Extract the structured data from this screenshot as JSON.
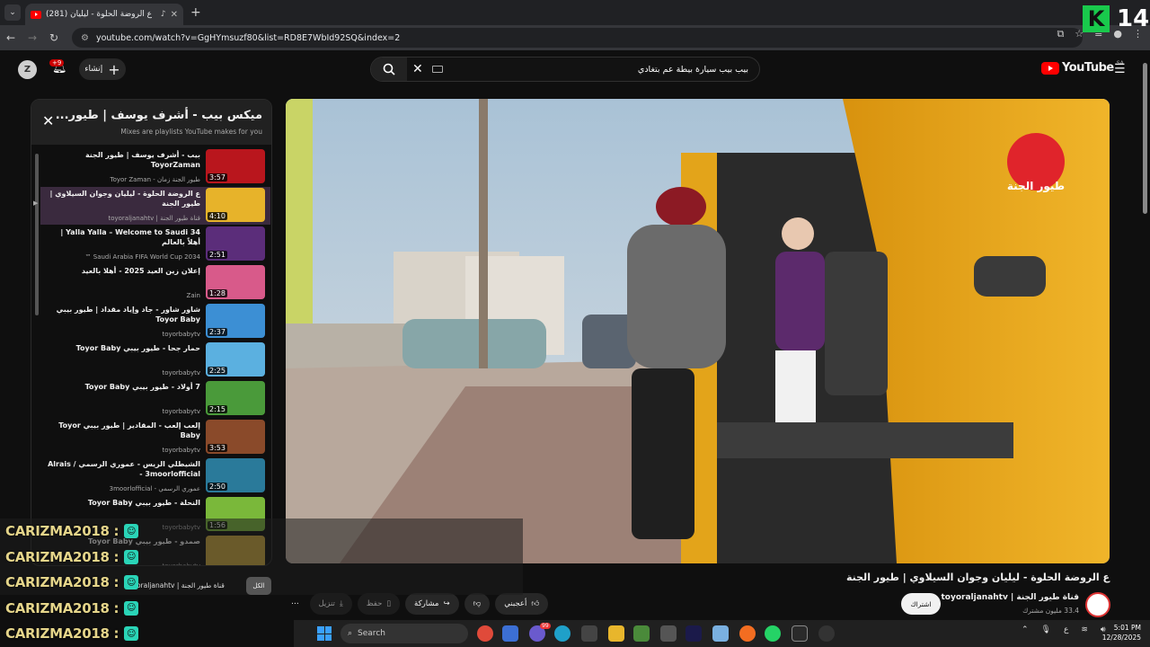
{
  "browser": {
    "tab_title": "(281) ع الروضة الحلوة - ليليان",
    "url": "youtube.com/watch?v=GgHYmsuzf80&list=RD8E7WbId92SQ&index=2"
  },
  "overlay_logo": {
    "letter": "K",
    "number": "14"
  },
  "youtube_header": {
    "avatar_letter": "Z",
    "notification_count": "+9",
    "create_label": "إنشاء",
    "search_query": "بيب بيب سيارة بيطة عم بتغادي",
    "logo_text": "YouTube",
    "region": "SA"
  },
  "playlist": {
    "title": "ميكس بيب - أشرف يوسف | طيور...",
    "subtitle": "Mixes are playlists YouTube makes for you",
    "items": [
      {
        "title": "بيب - أشرف يوسف | طيور الجنة ToyorZaman",
        "channel": "طيور الجنة زمان - Toyor Zaman",
        "duration": "3:57",
        "active": false,
        "color": "#b9161d"
      },
      {
        "title": "ع الروضة الحلوة - ليليان وجوان السيلاوي | طيور الجنة",
        "channel": "قناة طيور الجنة | toyoraljanahtv",
        "duration": "4:10",
        "active": true,
        "color": "#e7b32a"
      },
      {
        "title": "Yalla Yalla – Welcome to Saudi 34 | أهلاً بالعالم",
        "channel": "Saudi Arabia FIFA World Cup 2034 ™",
        "duration": "2:51",
        "active": false,
        "color": "#5b2d7a"
      },
      {
        "title": "إعلان زين العيد 2025 - أهلا بالعيد",
        "channel": "Zain",
        "duration": "1:28",
        "active": false,
        "color": "#d85a8a"
      },
      {
        "title": "شاور شاور - جاد وإياد مقداد | طيور بيبي Toyor Baby",
        "channel": "toyorbabytv",
        "duration": "2:37",
        "active": false,
        "color": "#3c8fd4"
      },
      {
        "title": "حمار جحا - طيور بيبي Toyor Baby",
        "channel": "toyorbabytv",
        "duration": "2:25",
        "active": false,
        "color": "#5bb0e0"
      },
      {
        "title": "7 أولاد - طيور بيبي Toyor Baby",
        "channel": "toyorbabytv",
        "duration": "2:15",
        "active": false,
        "color": "#4a9a3a"
      },
      {
        "title": "إلعب إلعب - المقادير | طيور بيبي Toyor Baby",
        "channel": "toyorbabytv",
        "duration": "3:53",
        "active": false,
        "color": "#8a4a2a"
      },
      {
        "title": "الشيطلي الريس - عموري الرسمي / Alrais - 3moorlofficial",
        "channel": "عموري الرسمي - 3moorlofficial",
        "duration": "2:50",
        "active": false,
        "color": "#2a7a9a"
      },
      {
        "title": "النحلة - طيور بيبي Toyor Baby",
        "channel": "toyorbabytv",
        "duration": "1:56",
        "active": false,
        "color": "#7ab83a"
      },
      {
        "title": "صمدو - طيور بيبي Toyor Baby",
        "channel": "toyorbabytv",
        "duration": "",
        "active": false,
        "color": "#c7a43a"
      }
    ]
  },
  "video": {
    "watermark": "طيور الجنة",
    "title": "ع الروضة الحلوة - ليليان وجوان السيلاوي | طيور الجنة",
    "channel": "قناة طيور الجنة | toyoraljanahtv",
    "subscribers": "33.4 مليون مشترك",
    "subscribe_label": "اشتراك",
    "actions": {
      "like": "أعجبني",
      "share": "مشاركة",
      "save": "حفظ",
      "download": "تنزيل"
    }
  },
  "live_overlay": {
    "chip": "الكل",
    "channel_text": "قناة طيور الجنة | toyoraljanahtv",
    "chat_lines": [
      "CARIZMA2018 :",
      "CARIZMA2018 :",
      "CARIZMA2018 :",
      "CARIZMA2018 :",
      "CARIZMA2018 :"
    ]
  },
  "taskbar": {
    "search_placeholder": "Search",
    "lang": "ع",
    "time": "5:01 PM",
    "date": "12/28/2025",
    "badge": "99"
  }
}
